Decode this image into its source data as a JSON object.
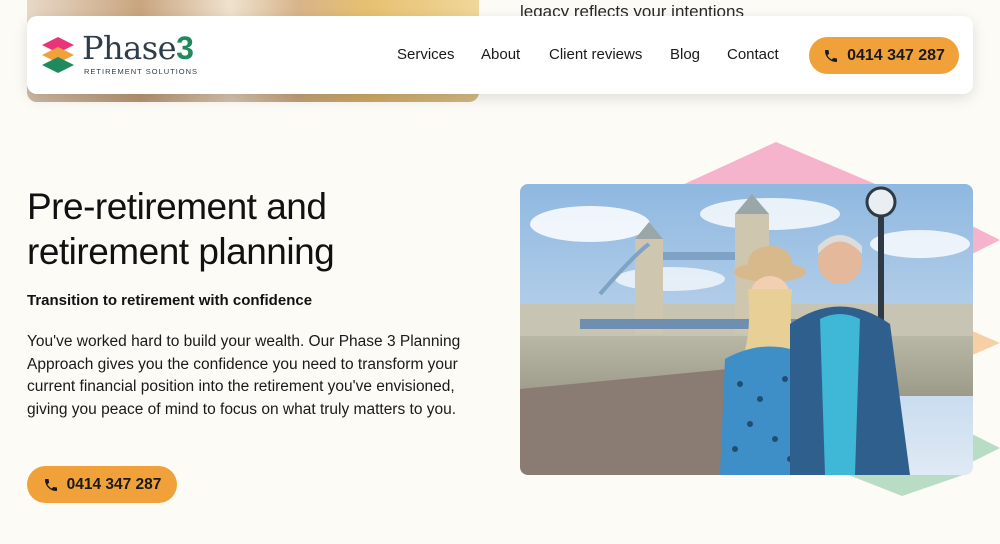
{
  "top": {
    "text": "legacy reflects your intentions"
  },
  "logo": {
    "word": "Phase",
    "number": "3",
    "tagline": "RETIREMENT SOLUTIONS"
  },
  "nav": {
    "items": [
      {
        "label": "Services"
      },
      {
        "label": "About"
      },
      {
        "label": "Client reviews"
      },
      {
        "label": "Blog"
      },
      {
        "label": "Contact"
      }
    ],
    "phone": "0414 347 287"
  },
  "main": {
    "title": "Pre-retirement and retirement planning",
    "subtitle": "Transition to retirement with confidence",
    "body": "You've worked hard to build your wealth. Our Phase 3 Planning Approach gives you the confidence you need to transform your current financial position into the retirement you've envisioned, giving you peace of mind to focus on what truly matters to you.",
    "phone": "0414 347 287"
  },
  "colors": {
    "accent": "#f0a13a",
    "brand_green": "#1f8a5b",
    "brand_pink": "#e8347a",
    "deco_pink": "#f5b3cc",
    "deco_peach": "#f6cfa6",
    "deco_green": "#b9dcc4"
  },
  "icons": [
    "phone-icon",
    "logo-mark-icon"
  ]
}
